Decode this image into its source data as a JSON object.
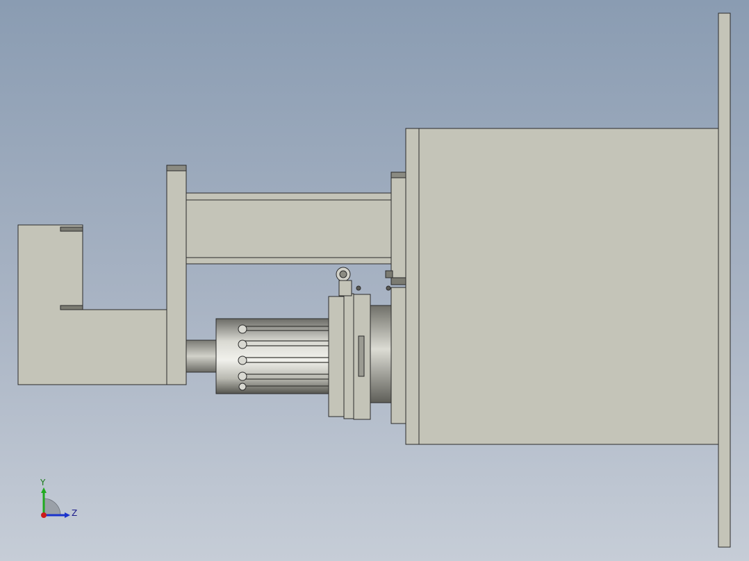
{
  "viewport": {
    "background_top": "#8a9cb2",
    "background_bottom": "#c6cdd7"
  },
  "model": {
    "part_fill": "#c4c4b8",
    "part_stroke": "#2a2a2a",
    "shadow_fill": "#7b7b72",
    "metal_dark": "#5a5a55",
    "metal_light": "#e6e6e0"
  },
  "triad": {
    "y_label": "Y",
    "z_label": "Z",
    "y_color": "#1faa1f",
    "z_color": "#1a33cc",
    "origin_color": "#cc1a1a"
  }
}
